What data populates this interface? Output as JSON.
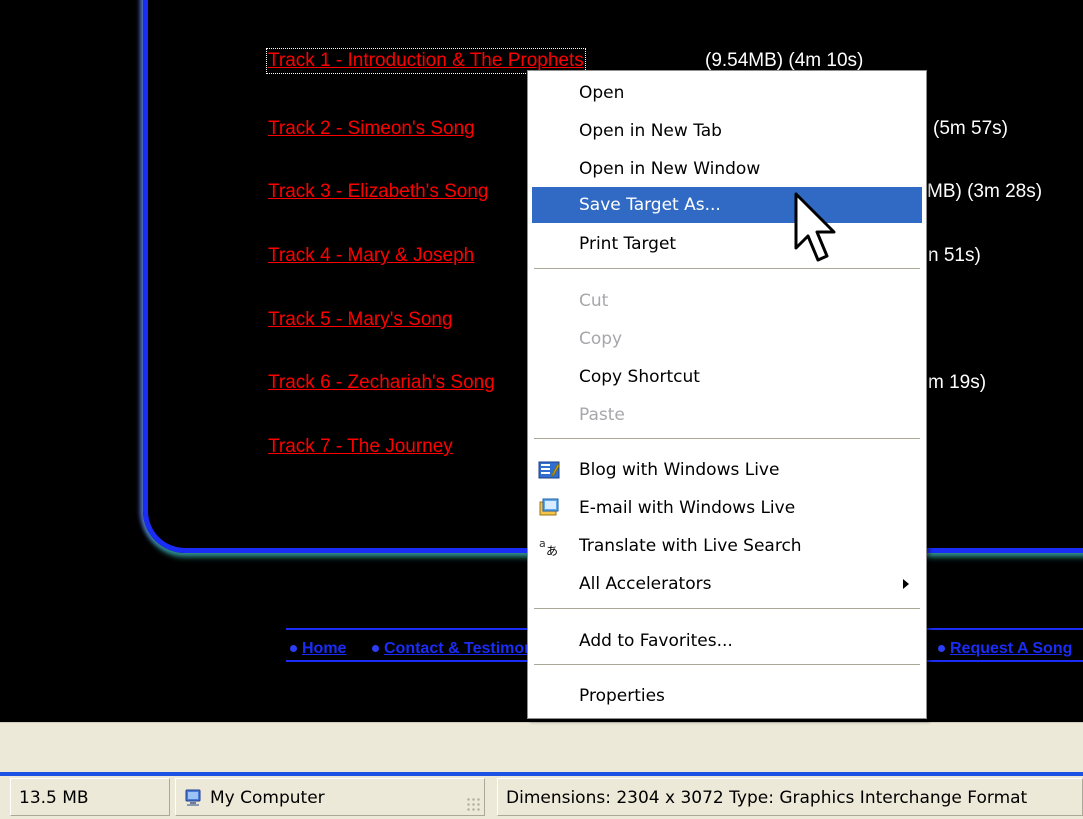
{
  "tracks": [
    {
      "title": "Track 1 - Introduction & The Prophets",
      "info": "(9.54MB) (4m 10s)"
    },
    {
      "title": "Track 2 - Simeon's Song",
      "info": "(5m 57s)"
    },
    {
      "title": "Track 3 - Elizabeth's Song",
      "info": "MB) (3m 28s)"
    },
    {
      "title": "Track 4 - Mary & Joseph",
      "info": "n 51s)"
    },
    {
      "title": "Track 5 - Mary's Song",
      "info": ""
    },
    {
      "title": "Track 6 - Zechariah's Song",
      "info": "m 19s)"
    },
    {
      "title": "Track 7 - The Journey",
      "info": ""
    }
  ],
  "footer_nav": {
    "home": "Home",
    "contact": "Contact & Testimonials",
    "request": "Request A Song"
  },
  "context_menu": {
    "open": "Open",
    "open_new_tab": "Open in New Tab",
    "open_new_window": "Open in New Window",
    "save_target_as": "Save Target As...",
    "print_target": "Print Target",
    "cut": "Cut",
    "copy": "Copy",
    "copy_shortcut": "Copy Shortcut",
    "paste": "Paste",
    "blog_live": "Blog with Windows Live",
    "email_live": "E-mail with Windows Live",
    "translate_live": "Translate with Live Search",
    "all_accelerators": "All Accelerators",
    "add_favorites": "Add to Favorites...",
    "properties": "Properties"
  },
  "status_bar": {
    "size": "13.5 MB",
    "zone": "My Computer",
    "info": "Dimensions: 2304 x 3072 Type: Graphics Interchange Format"
  },
  "colors": {
    "link": "#ff0000",
    "frame": "#1a2cf5",
    "menu_highlight": "#316ac5",
    "status_accent": "#1c53e5"
  },
  "icons": [
    "blog-icon",
    "email-icon",
    "translate-icon",
    "computer-icon",
    "cursor-icon"
  ]
}
